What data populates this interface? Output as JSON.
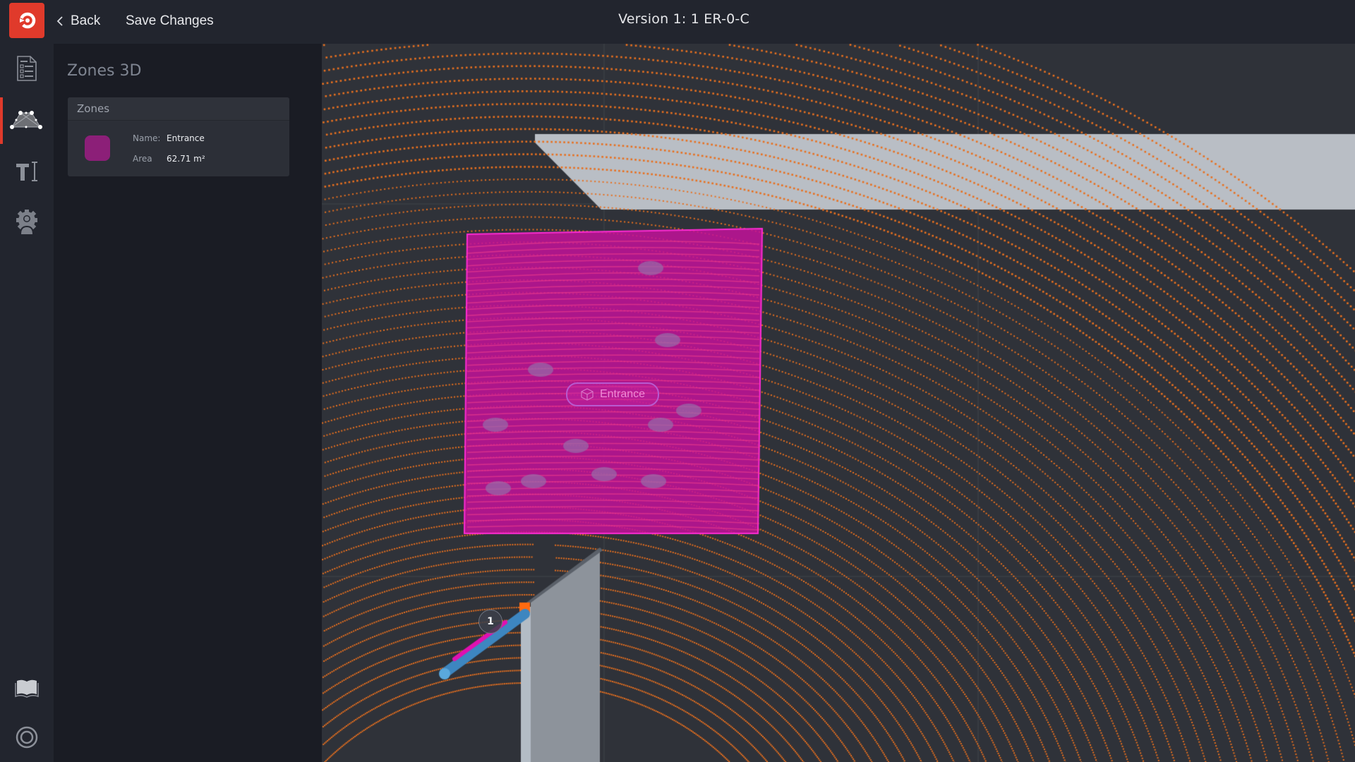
{
  "header": {
    "logo_icon": "brand-logo-icon",
    "back_label": "Back",
    "back_icon": "chevron-left-icon",
    "save_label": "Save Changes",
    "title": "Version 1: 1 ER-0-C"
  },
  "rail": {
    "items": [
      {
        "icon": "checklist-document-icon",
        "active": false
      },
      {
        "icon": "zones-3d-polygon-icon",
        "active": true
      },
      {
        "icon": "text-tool-icon",
        "active": false
      },
      {
        "icon": "user-settings-icon",
        "active": false
      }
    ],
    "bottom_items": [
      {
        "icon": "book-icon"
      },
      {
        "icon": "help-circle-icon"
      }
    ],
    "active_color": "#e03a2b"
  },
  "panel": {
    "title": "Zones 3D",
    "zones_header": "Zones",
    "zones": [
      {
        "name_label": "Name:",
        "name": "Entrance",
        "area_label": "Area",
        "area": "62.71 m²",
        "color": "#8c1f78"
      }
    ]
  },
  "viewport": {
    "zone_tag": {
      "icon": "cube-icon",
      "label": "Entrance"
    },
    "sensor_badge": "1",
    "colors": {
      "background": "#2f3239",
      "points": "#e8701f",
      "zone_fill": "#c2129a",
      "zone_edge": "#ff2bd4",
      "wall": "#b9bec5",
      "sensor": "#3d86c0"
    }
  }
}
